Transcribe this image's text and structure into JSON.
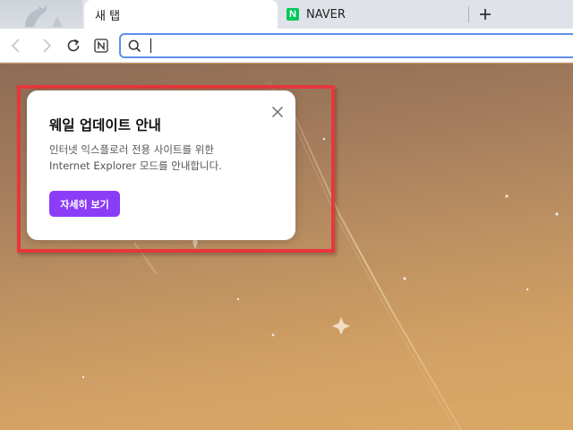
{
  "tabs": [
    {
      "label": "새 탭",
      "active": true
    },
    {
      "label": "NAVER",
      "active": false,
      "favicon_letter": "N",
      "favicon_color": "#03c75a"
    }
  ],
  "icons": {
    "logo": "whale-logo-icon",
    "new_tab": "plus-icon",
    "back": "back-arrow-icon",
    "forward": "forward-arrow-icon",
    "reload": "reload-icon",
    "naver_shortcut": "naver-n-icon",
    "search": "search-icon",
    "close": "close-icon"
  },
  "address_bar": {
    "value": "",
    "placeholder": ""
  },
  "popup": {
    "title": "웨일 업데이트 안내",
    "description_line1": "인터넷 익스플로러 전용 사이트를 위한",
    "description_line2": "Internet Explorer 모드를 안내합니다.",
    "button_label": "자세히 보기",
    "button_color": "#8b3cf7",
    "highlight_color": "#e8363c"
  }
}
